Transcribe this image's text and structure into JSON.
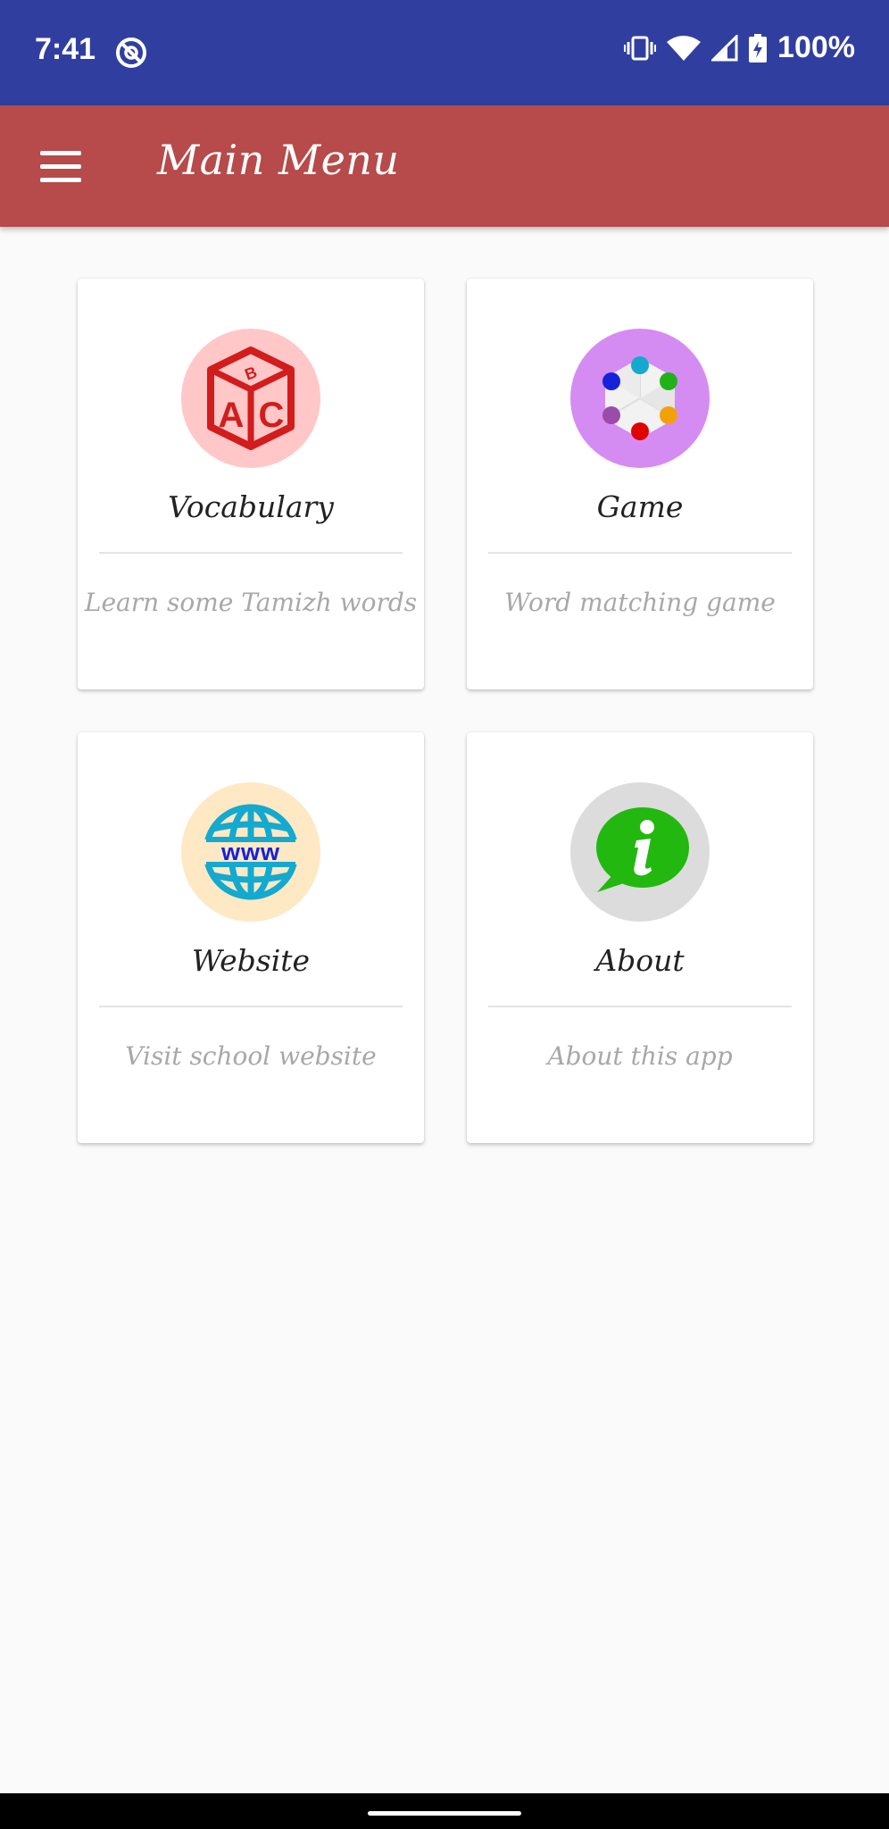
{
  "status_bar": {
    "time": "7:41",
    "battery_text": "100%",
    "icons": [
      "dnd-icon",
      "vibrate-icon",
      "wifi-icon",
      "signal-icon",
      "battery-charging-icon"
    ],
    "background": "#303f9f"
  },
  "app_bar": {
    "title": "Main Menu",
    "menu_icon": "hamburger-menu-icon",
    "background": "#b74a4a"
  },
  "cards": [
    {
      "title": "Vocabulary",
      "subtitle": "Learn some Tamizh words",
      "icon": "abc-block-icon",
      "icon_bg": "#ffc7c7"
    },
    {
      "title": "Game",
      "subtitle": "Word matching game",
      "icon": "colored-dots-hexagon-icon",
      "icon_bg": "#d58cf2"
    },
    {
      "title": "Website",
      "subtitle": "Visit school website",
      "icon": "www-globe-icon",
      "icon_bg": "#ffe8c4"
    },
    {
      "title": "About",
      "subtitle": "About this app",
      "icon": "info-chat-bubble-icon",
      "icon_bg": "#dcdcdc"
    }
  ]
}
